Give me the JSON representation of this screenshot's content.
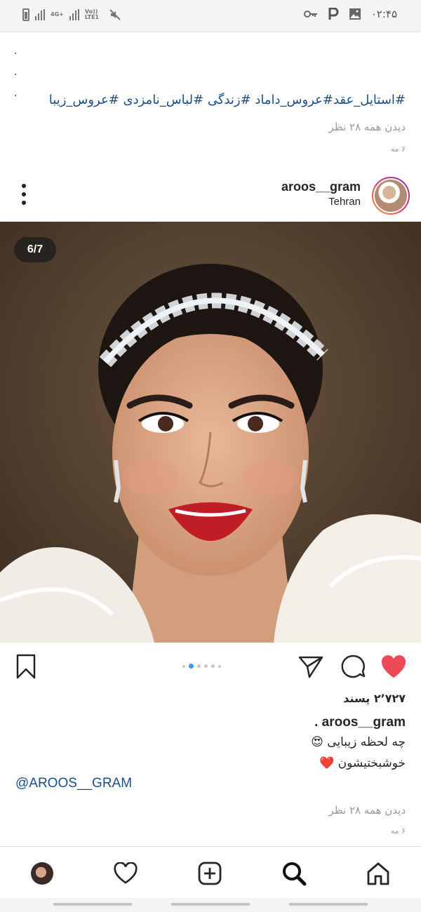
{
  "status_bar": {
    "time": "۰۲:۴۵",
    "network_1": "4G+",
    "network_2": "Vo)) LTE1"
  },
  "previous_post": {
    "dots": [
      ".",
      ".",
      "."
    ],
    "hashtags": "#استایل_عقد#عروس_داماد #زندگی #لباس_نامزدی #عروس_زیبا",
    "see_all": "دیدن همه ۲۸ نظر",
    "date": "۶ مه"
  },
  "post": {
    "username": "aroos__gram",
    "location": "Tehran",
    "carousel_counter": "6/7",
    "carousel_total": 7,
    "carousel_index": 6,
    "likes": "۲٬۷۲۷ پسند",
    "caption_username": "aroos__gram .",
    "caption_line_1": "چه لحظه زیبایی 😍",
    "caption_line_2": "خوشبختیشون ❤️",
    "mention": "@AROOS__GRAM",
    "see_all": "دیدن همه ۲۸ نظر",
    "date": "۶ مه",
    "liked": true,
    "like_color": "#ed4956"
  },
  "icons": {
    "more": "more-options-icon",
    "bookmark": "bookmark-icon",
    "share": "send-icon",
    "comment": "comment-icon",
    "like": "heart-icon",
    "nav_home": "home-icon",
    "nav_search": "search-icon",
    "nav_add": "add-post-icon",
    "nav_activity": "heart-outline-icon",
    "nav_profile": "profile-avatar"
  },
  "colors": {
    "link": "#1a4e8a",
    "muted": "#9a9a9a",
    "pager_active": "#3897f0"
  }
}
